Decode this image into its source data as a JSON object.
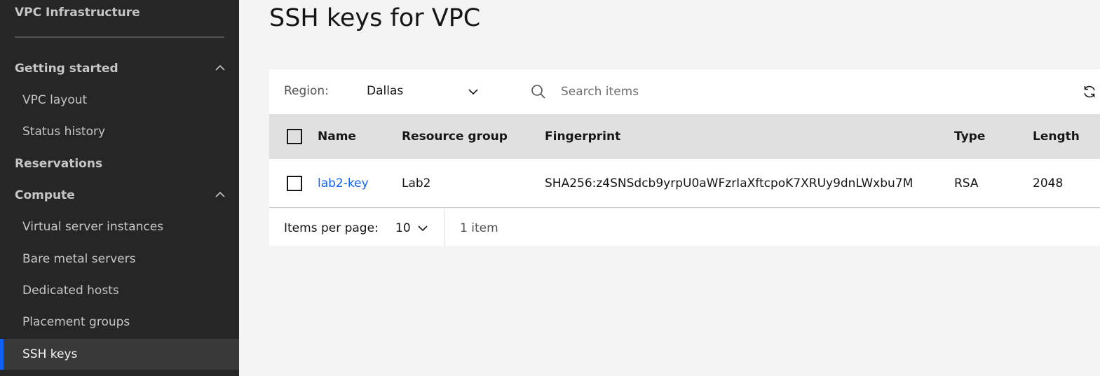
{
  "sidebar": {
    "title": "VPC Infrastructure",
    "sections": [
      {
        "label": "Getting started"
      },
      {
        "label": "Reservations"
      },
      {
        "label": "Compute"
      }
    ],
    "getting_started_items": [
      "VPC layout",
      "Status history"
    ],
    "compute_items": [
      "Virtual server instances",
      "Bare metal servers",
      "Dedicated hosts",
      "Placement groups",
      "SSH keys"
    ],
    "active_item": "SSH keys",
    "accent_color": "#0f62fe"
  },
  "page": {
    "title": "SSH keys for VPC"
  },
  "toolbar": {
    "region_label": "Region:",
    "region_value": "Dallas",
    "search_placeholder": "Search items"
  },
  "table": {
    "columns": [
      "Name",
      "Resource group",
      "Fingerprint",
      "Type",
      "Length"
    ],
    "rows": [
      {
        "name": "lab2-key",
        "resource_group": "Lab2",
        "fingerprint": "SHA256:z4SNSdcb9yrpU0aWFzrIaXftcpoK7XRUy9dnLWxbu7M",
        "type": "RSA",
        "length": "2048"
      }
    ]
  },
  "pagination": {
    "items_per_page_label": "Items per page:",
    "items_per_page_value": "10",
    "count_text": "1 item"
  }
}
